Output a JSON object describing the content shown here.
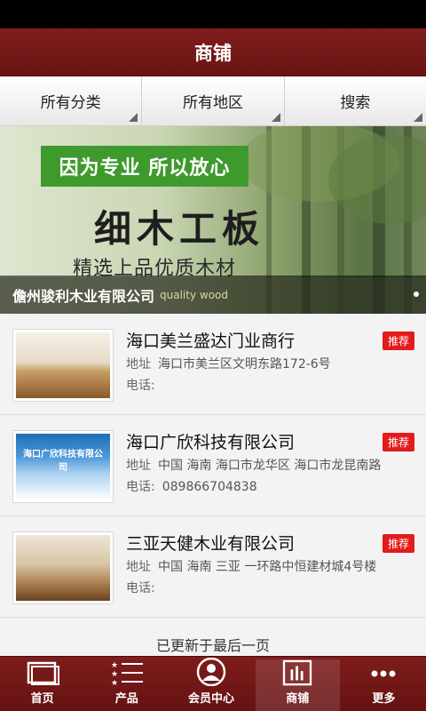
{
  "header": {
    "title": "商铺"
  },
  "filters": [
    {
      "label": "所有分类"
    },
    {
      "label": "所有地区"
    },
    {
      "label": "搜索"
    }
  ],
  "banner": {
    "slogan": "因为专业 所以放心",
    "headline": "细木工板",
    "subline": "精选上品优质木材",
    "caption": "儋州骏利木业有限公司",
    "caption_en": "quality wood"
  },
  "listings": [
    {
      "name": "海口美兰盛达门业商行",
      "address_label": "地址",
      "address": "海口市美兰区文明东路172-6号",
      "phone_label": "电话:",
      "phone": "",
      "badge": "推荐"
    },
    {
      "name": "海口广欣科技有限公司",
      "address_label": "地址",
      "address": "中国 海南 海口市龙华区 海口市龙昆南路",
      "phone_label": "电话:",
      "phone": "089866704838",
      "badge": "推荐",
      "thumb_text": "海口广欣科技有限公司"
    },
    {
      "name": "三亚天健木业有限公司",
      "address_label": "地址",
      "address": "中国 海南 三亚 一环路中恒建材城4号楼",
      "phone_label": "电话:",
      "phone": "",
      "badge": "推荐"
    }
  ],
  "footer_message": "已更新于最后一页",
  "tabs": [
    {
      "label": "首页",
      "icon": "home-icon"
    },
    {
      "label": "产品",
      "icon": "star-list-icon"
    },
    {
      "label": "会员中心",
      "icon": "user-icon"
    },
    {
      "label": "商铺",
      "icon": "chart-icon",
      "active": true
    },
    {
      "label": "更多",
      "icon": "more-icon"
    }
  ],
  "colors": {
    "brand": "#7a1a1a",
    "badge": "#e31b1b",
    "banner_green": "#3f9a2d"
  }
}
